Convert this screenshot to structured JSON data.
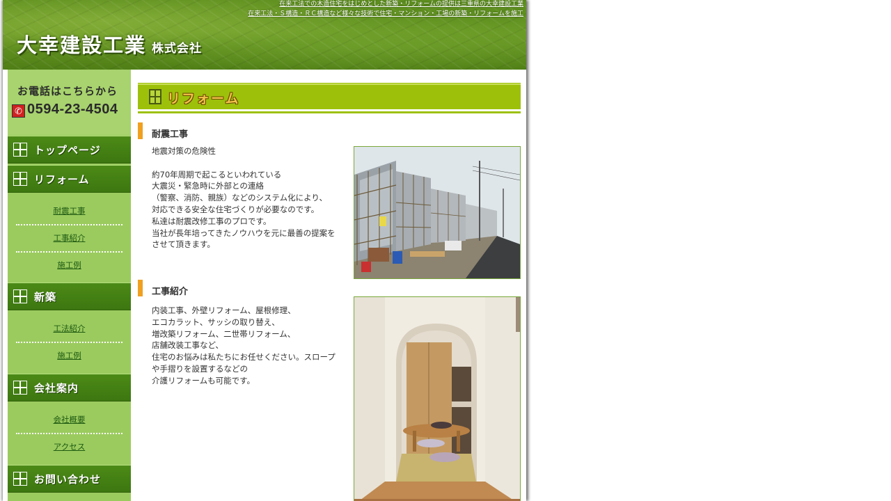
{
  "header": {
    "tagline1": "在来工法での木造住宅をはじめとした新築・リフォームの提供は三重県の大幸建設工業",
    "tagline2": "在来工法・Ｓ構造・ＲＣ構造など様々な技術で住宅・マンション・工場の新築・リフォームを施工",
    "logo_main": "大幸建設工業",
    "logo_sub": "株式会社"
  },
  "sidebar": {
    "phone_label": "お電話はこちらから",
    "phone_icon": "phone-icon",
    "phone_number": "0594-23-4504",
    "nav": [
      {
        "label": "トップページ",
        "links": []
      },
      {
        "label": "リフォーム",
        "links": [
          "耐震工事",
          "工事紹介",
          "施工例"
        ]
      },
      {
        "label": "新築",
        "links": [
          "工法紹介",
          "施工例"
        ]
      },
      {
        "label": "会社案内",
        "links": [
          "会社概要",
          "アクセス"
        ]
      },
      {
        "label": "お問い合わせ",
        "links": []
      }
    ]
  },
  "main": {
    "title": "リフォーム",
    "sections": [
      {
        "heading": "耐震工事",
        "lines": [
          "地震対策の危険性",
          "",
          "約70年周期で起こるといわれている",
          "大震災・緊急時に外部との連絡",
          "（警察、消防、親族）などのシステム化により、",
          "対応できる安全な住宅づくりが必要なのです。",
          "私達は耐震改修工事のプロです。",
          "当社が長年培ってきたノウハウを元に最善の提案を",
          "させて頂きます。"
        ],
        "image": "construction-site-photo"
      },
      {
        "heading": "工事紹介",
        "lines": [
          "内装工事、外壁リフォーム、屋根修理、",
          "エコカラット、サッシの取り替え、",
          "増改築リフォーム、二世帯リフォーム、",
          "店舗改装工事など、",
          "住宅のお悩みは私たちにお任せください。スロープ",
          "や手摺りを設置するなどの",
          "介護リフォームも可能です。"
        ],
        "image": "interior-room-photo"
      }
    ]
  },
  "colors": {
    "header_green": "#5f8f1f",
    "sidebar_green": "#9bcb5f",
    "nav_dark_green": "#3c7710",
    "title_bar_green": "#9dc10a",
    "accent_orange": "#f0a020",
    "link_green": "#1f5a12"
  }
}
